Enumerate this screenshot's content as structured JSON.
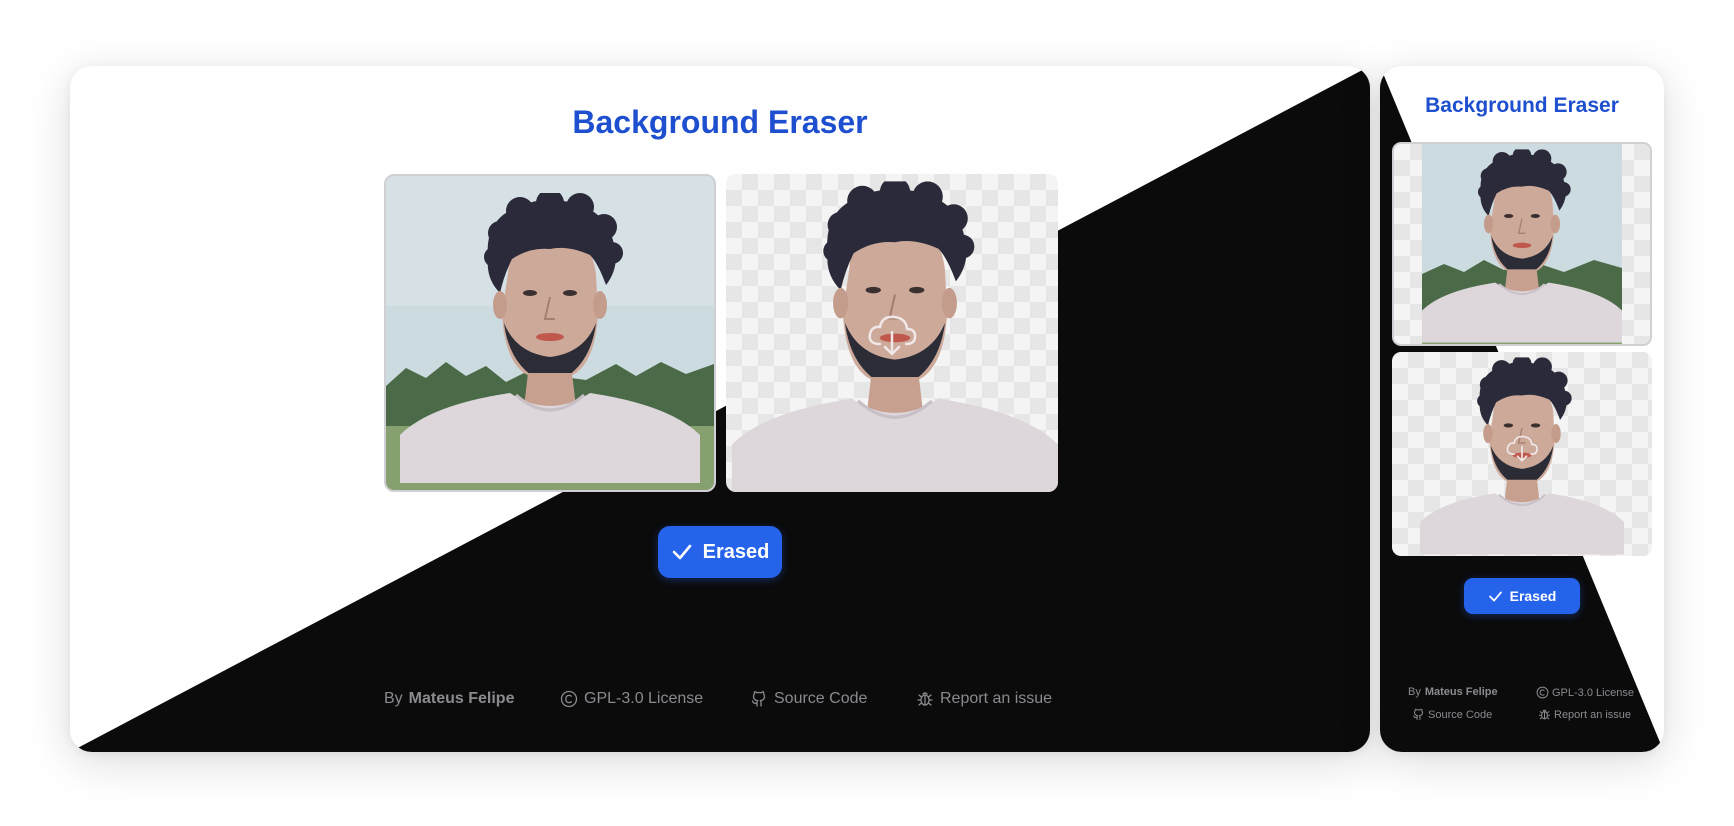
{
  "app": {
    "title": "Background Eraser",
    "status_label": "Erased"
  },
  "footer": {
    "by_prefix": "By",
    "author": "Mateus Felipe",
    "license": "GPL-3.0 License",
    "source": "Source Code",
    "issue": "Report an issue"
  },
  "icons": {
    "status": "check-icon",
    "download": "cloud-download-icon",
    "license": "copyright-icon",
    "source": "github-icon",
    "issue": "bug-icon"
  },
  "colors": {
    "accent": "#2563eb",
    "title": "#1e4fcf",
    "dark_theme": "#0b0b0c",
    "light_theme": "#ffffff"
  }
}
